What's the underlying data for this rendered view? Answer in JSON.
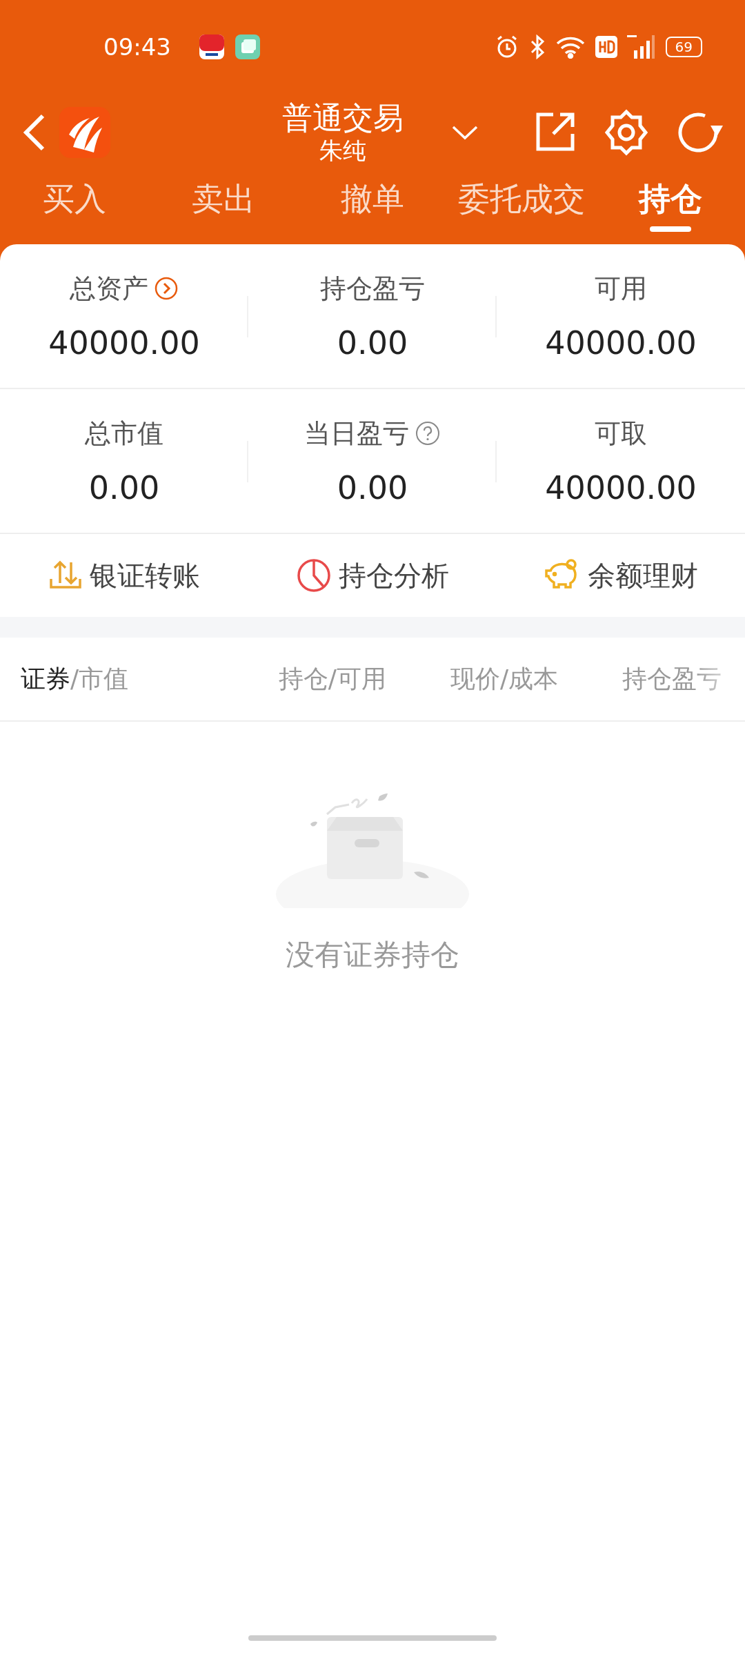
{
  "status_bar": {
    "time": "09:43",
    "battery": "69"
  },
  "header": {
    "title": "普通交易",
    "subtitle": "朱纯"
  },
  "tabs": [
    {
      "label": "买入",
      "selected": false
    },
    {
      "label": "卖出",
      "selected": false
    },
    {
      "label": "撤单",
      "selected": false
    },
    {
      "label": "委托成交",
      "selected": false
    },
    {
      "label": "持仓",
      "selected": true
    }
  ],
  "summary": [
    {
      "label": "总资产",
      "value": "40000.00",
      "kind": "link"
    },
    {
      "label": "持仓盈亏",
      "value": "0.00",
      "kind": "plain"
    },
    {
      "label": "可用",
      "value": "40000.00",
      "kind": "plain"
    },
    {
      "label": "总市值",
      "value": "0.00",
      "kind": "plain"
    },
    {
      "label": "当日盈亏",
      "value": "0.00",
      "kind": "help"
    },
    {
      "label": "可取",
      "value": "40000.00",
      "kind": "plain"
    }
  ],
  "actions": [
    {
      "label": "银证转账",
      "kind": "transfer"
    },
    {
      "label": "持仓分析",
      "kind": "analysis"
    },
    {
      "label": "余额理财",
      "kind": "piggy"
    }
  ],
  "table": {
    "columns": [
      {
        "label": "证券/市值",
        "selected": true
      },
      {
        "label": "持仓/可用",
        "selected": false
      },
      {
        "label": "现价/成本",
        "selected": false
      },
      {
        "label": "持仓盈亏",
        "selected": false
      }
    ],
    "empty_text": "没有证券持仓"
  }
}
